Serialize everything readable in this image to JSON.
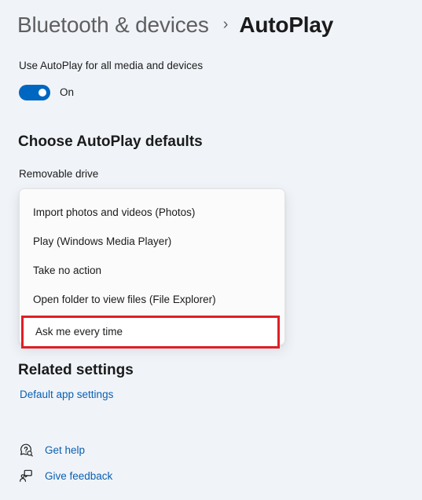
{
  "breadcrumb": {
    "parent": "Bluetooth & devices",
    "separator": "›",
    "current": "AutoPlay"
  },
  "autoplay": {
    "label": "Use AutoPlay for all media and devices",
    "toggle_state": "On",
    "toggle_on": true
  },
  "defaults": {
    "heading": "Choose AutoPlay defaults",
    "removable_drive_label": "Removable drive",
    "options": [
      "Import photos and videos (Photos)",
      "Play (Windows Media Player)",
      "Take no action",
      "Open folder to view files (File Explorer)",
      "Ask me every time"
    ],
    "selected_option": "Ask me every time"
  },
  "related": {
    "heading": "Related settings",
    "default_apps_link": "Default app settings"
  },
  "help": {
    "get_help": "Get help",
    "get_help_icon": "help-chat-icon",
    "give_feedback": "Give feedback",
    "give_feedback_icon": "feedback-icon"
  },
  "colors": {
    "accent": "#0067c0",
    "link": "#0a5fb0",
    "highlight_border": "#e01e26",
    "background": "#f0f4f9"
  }
}
